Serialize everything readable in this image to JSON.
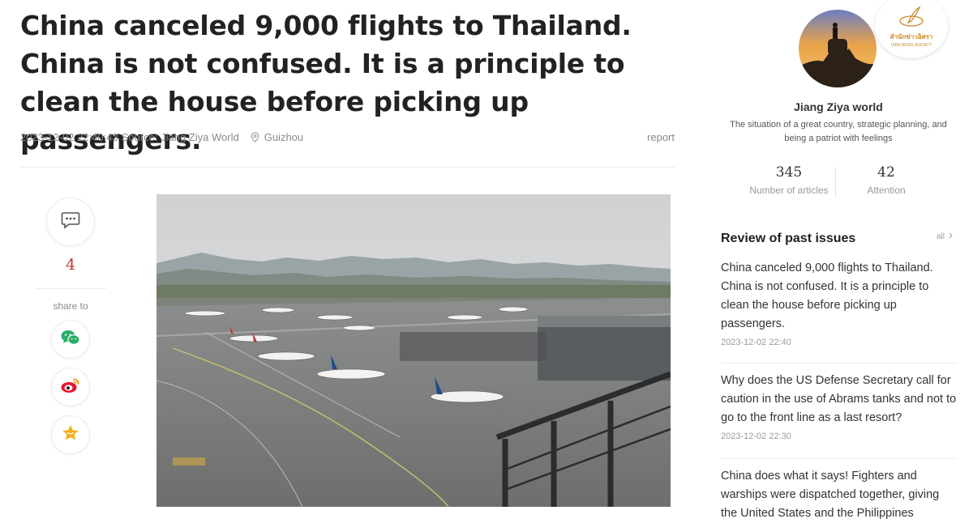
{
  "article": {
    "title": "China canceled 9,000 flights to Thailand. China is not confused. It is a principle to clean the house before picking up passengers.",
    "timestamp": "2023-12-02 22:40:43",
    "source": "Source: Jiang Ziya World",
    "location": "Guizhou",
    "report_label": "report"
  },
  "social": {
    "comment_count": "4",
    "share_label": "share to",
    "share_targets": [
      "wechat-icon",
      "weibo-icon",
      "favorite-star-icon"
    ]
  },
  "profile": {
    "name": "Jiang Ziya world",
    "description": "The situation of a great country, strategic planning, and being a patriot with feelings",
    "articles_count": "345",
    "articles_label": "Number of articles",
    "attention_count": "42",
    "attention_label": "Attention",
    "badge_text": "สำนักข่าวอิศรา",
    "badge_subtext": "ISRA NEWS AGENCY"
  },
  "review": {
    "heading": "Review of past issues",
    "all_label": "all",
    "issues": [
      {
        "title": "China canceled 9,000 flights to Thailand. China is not confused. It is a principle to clean the house before picking up passengers.",
        "date": "2023-12-02 22:40"
      },
      {
        "title": "Why does the US Defense Secretary call for caution in the use of Abrams tanks and not to go to the front line as a last resort?",
        "date": "2023-12-02 22:30"
      },
      {
        "title": "China does what it says! Fighters and warships were dispatched together, giving the United States and the Philippines",
        "date": ""
      }
    ]
  },
  "colors": {
    "accent_red": "#c0392b",
    "wechat_green": "#2aae67",
    "weibo_red": "#e6162d",
    "star_gold": "#f2b01e",
    "badge_gold": "#c98a2a"
  }
}
